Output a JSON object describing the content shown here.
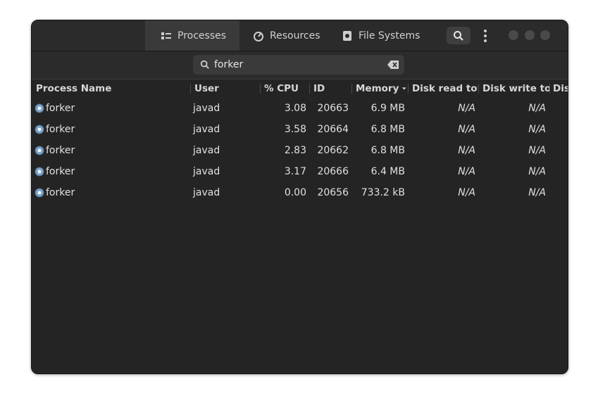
{
  "tabs": [
    {
      "label": "Processes",
      "icon": "processes-list-icon",
      "active": true
    },
    {
      "label": "Resources",
      "icon": "resources-gauge-icon",
      "active": false
    },
    {
      "label": "File Systems",
      "icon": "file-systems-disk-icon",
      "active": false
    }
  ],
  "search": {
    "value": "forker",
    "icon": "search-icon",
    "clear_icon": "clear-search-icon"
  },
  "columns": {
    "process_name": "Process Name",
    "user": "User",
    "cpu": "% CPU",
    "id": "ID",
    "memory": "Memory",
    "disk_read": "Disk read total",
    "disk_write": "Disk write total",
    "disk_more": "Disk"
  },
  "sort": {
    "column": "memory",
    "direction": "descending"
  },
  "rows": [
    {
      "name": "forker",
      "user": "javad",
      "cpu": "3.08",
      "id": "20663",
      "memory": "6.9 MB",
      "disk_read": "N/A",
      "disk_write": "N/A"
    },
    {
      "name": "forker",
      "user": "javad",
      "cpu": "3.58",
      "id": "20664",
      "memory": "6.8 MB",
      "disk_read": "N/A",
      "disk_write": "N/A"
    },
    {
      "name": "forker",
      "user": "javad",
      "cpu": "2.83",
      "id": "20662",
      "memory": "6.8 MB",
      "disk_read": "N/A",
      "disk_write": "N/A"
    },
    {
      "name": "forker",
      "user": "javad",
      "cpu": "3.17",
      "id": "20666",
      "memory": "6.4 MB",
      "disk_read": "N/A",
      "disk_write": "N/A"
    },
    {
      "name": "forker",
      "user": "javad",
      "cpu": "0.00",
      "id": "20656",
      "memory": "733.2 kB",
      "disk_read": "N/A",
      "disk_write": "N/A"
    }
  ],
  "colors": {
    "window_bg": "#242424",
    "headerbar_bg": "#2b2b2b",
    "active_tab": "#3a3a3a",
    "text": "#e0e0e0"
  }
}
